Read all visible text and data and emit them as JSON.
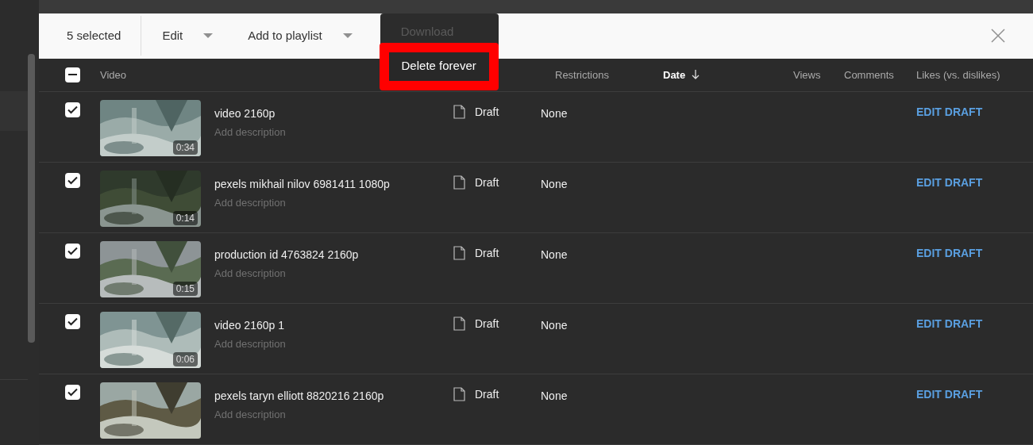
{
  "toolbar": {
    "selection_count": "5 selected",
    "actions": [
      {
        "label": "Edit",
        "kind": "dropdown"
      },
      {
        "label": "Add to playlist",
        "kind": "dropdown"
      },
      {
        "label": "Download",
        "kind": "button",
        "disabled": true
      }
    ],
    "menu": {
      "items": [
        {
          "label": "Delete forever",
          "highlighted": true
        }
      ]
    }
  },
  "table": {
    "select_all": {
      "indeterminate": true
    },
    "columns": [
      {
        "label": "Video",
        "sorted": false
      },
      {
        "label": "Restrictions",
        "sorted": false
      },
      {
        "label": "Date",
        "sorted": true
      },
      {
        "label": "Views",
        "sorted": false
      },
      {
        "label": "Comments",
        "sorted": false
      },
      {
        "label": "Likes (vs. dislikes)",
        "sorted": false
      }
    ],
    "rows": [
      {
        "checked": true,
        "title": "video 2160p",
        "description": "Add description",
        "duration": "0:34",
        "visibility": "Draft",
        "restrictions": "None",
        "action": "EDIT DRAFT"
      },
      {
        "checked": true,
        "title": "pexels mikhail nilov 6981411 1080p",
        "description": "Add description",
        "duration": "0:14",
        "visibility": "Draft",
        "restrictions": "None",
        "action": "EDIT DRAFT"
      },
      {
        "checked": true,
        "title": "production id 4763824 2160p",
        "description": "Add description",
        "duration": "0:15",
        "visibility": "Draft",
        "restrictions": "None",
        "action": "EDIT DRAFT"
      },
      {
        "checked": true,
        "title": "video 2160p 1",
        "description": "Add description",
        "duration": "0:06",
        "visibility": "Draft",
        "restrictions": "None",
        "action": "EDIT DRAFT"
      },
      {
        "checked": true,
        "title": "pexels taryn elliott 8820216 2160p",
        "description": "Add description",
        "visibility": "Draft",
        "restrictions": "None",
        "action": "EDIT DRAFT"
      }
    ]
  }
}
